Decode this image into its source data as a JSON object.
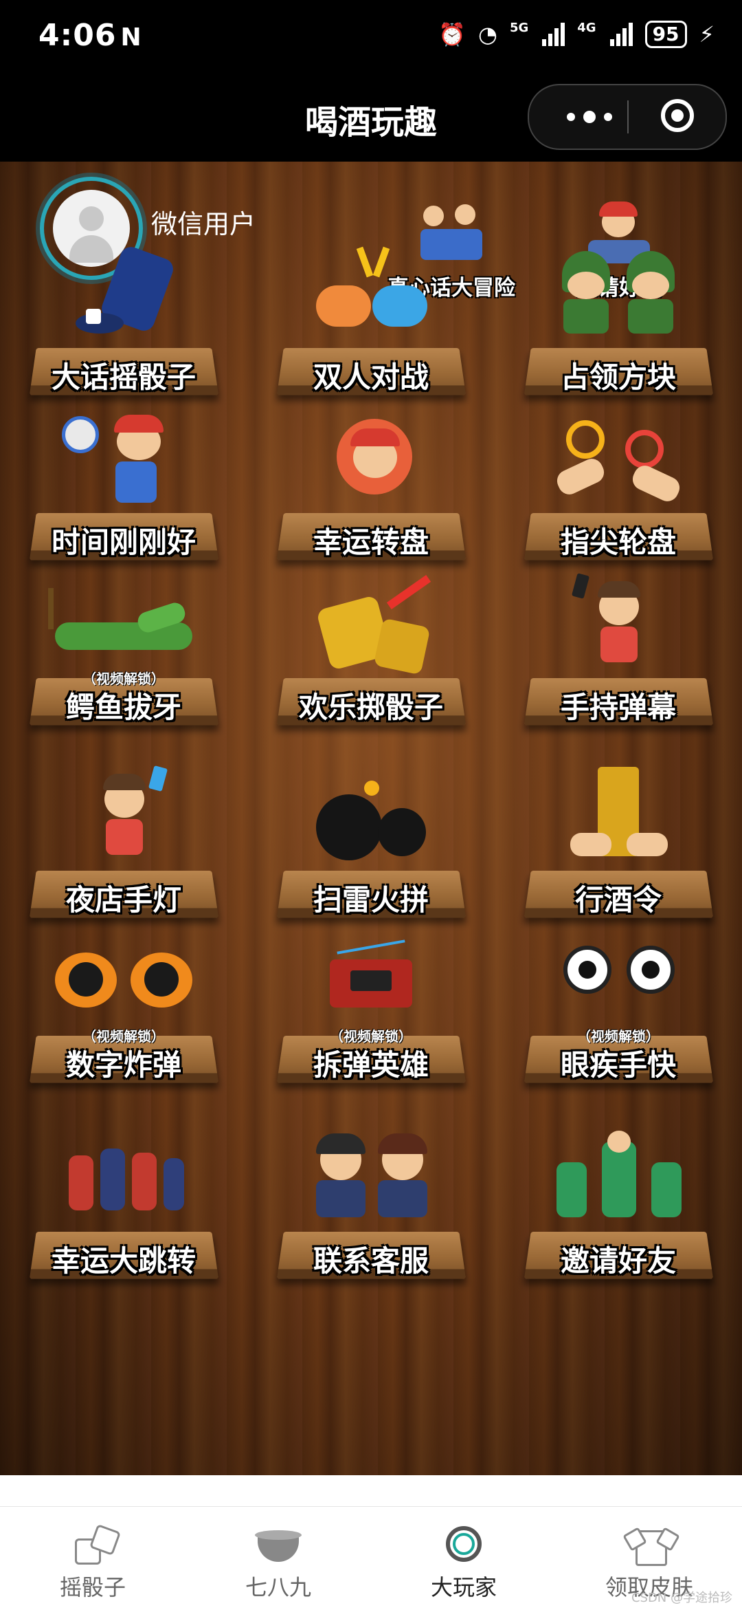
{
  "status": {
    "time": "4:06",
    "nfc": "N",
    "signal1": "5G",
    "signal2": "4G",
    "battery": "95"
  },
  "header": {
    "title": "喝酒玩趣"
  },
  "user": {
    "name": "微信用户"
  },
  "top_buttons": [
    {
      "label": "真心话大冒险"
    },
    {
      "label": "邀请好友"
    }
  ],
  "games": [
    {
      "label": "大话摇骰子",
      "tag": ""
    },
    {
      "label": "双人对战",
      "tag": ""
    },
    {
      "label": "占领方块",
      "tag": ""
    },
    {
      "label": "时间刚刚好",
      "tag": ""
    },
    {
      "label": "幸运转盘",
      "tag": ""
    },
    {
      "label": "指尖轮盘",
      "tag": ""
    },
    {
      "label": "鳄鱼拔牙",
      "tag": "（视频解锁）"
    },
    {
      "label": "欢乐掷骰子",
      "tag": ""
    },
    {
      "label": "手持弹幕",
      "tag": ""
    },
    {
      "label": "夜店手灯",
      "tag": ""
    },
    {
      "label": "扫雷火拼",
      "tag": ""
    },
    {
      "label": "行酒令",
      "tag": ""
    },
    {
      "label": "数字炸弹",
      "tag": "（视频解锁）"
    },
    {
      "label": "拆弹英雄",
      "tag": "（视频解锁）"
    },
    {
      "label": "眼疾手快",
      "tag": "（视频解锁）"
    },
    {
      "label": "幸运大跳转",
      "tag": ""
    },
    {
      "label": "联系客服",
      "tag": ""
    },
    {
      "label": "邀请好友",
      "tag": ""
    }
  ],
  "tabs": [
    {
      "label": "摇骰子",
      "icon": "dice-icon"
    },
    {
      "label": "七八九",
      "icon": "bowl-icon"
    },
    {
      "label": "大玩家",
      "icon": "ring-icon",
      "active": true
    },
    {
      "label": "领取皮肤",
      "icon": "shirt-icon"
    }
  ],
  "watermark": "CSDN @学途拾珍",
  "colors": {
    "accent_ring": "#2aa6b6",
    "wood": "#5a2f12"
  }
}
